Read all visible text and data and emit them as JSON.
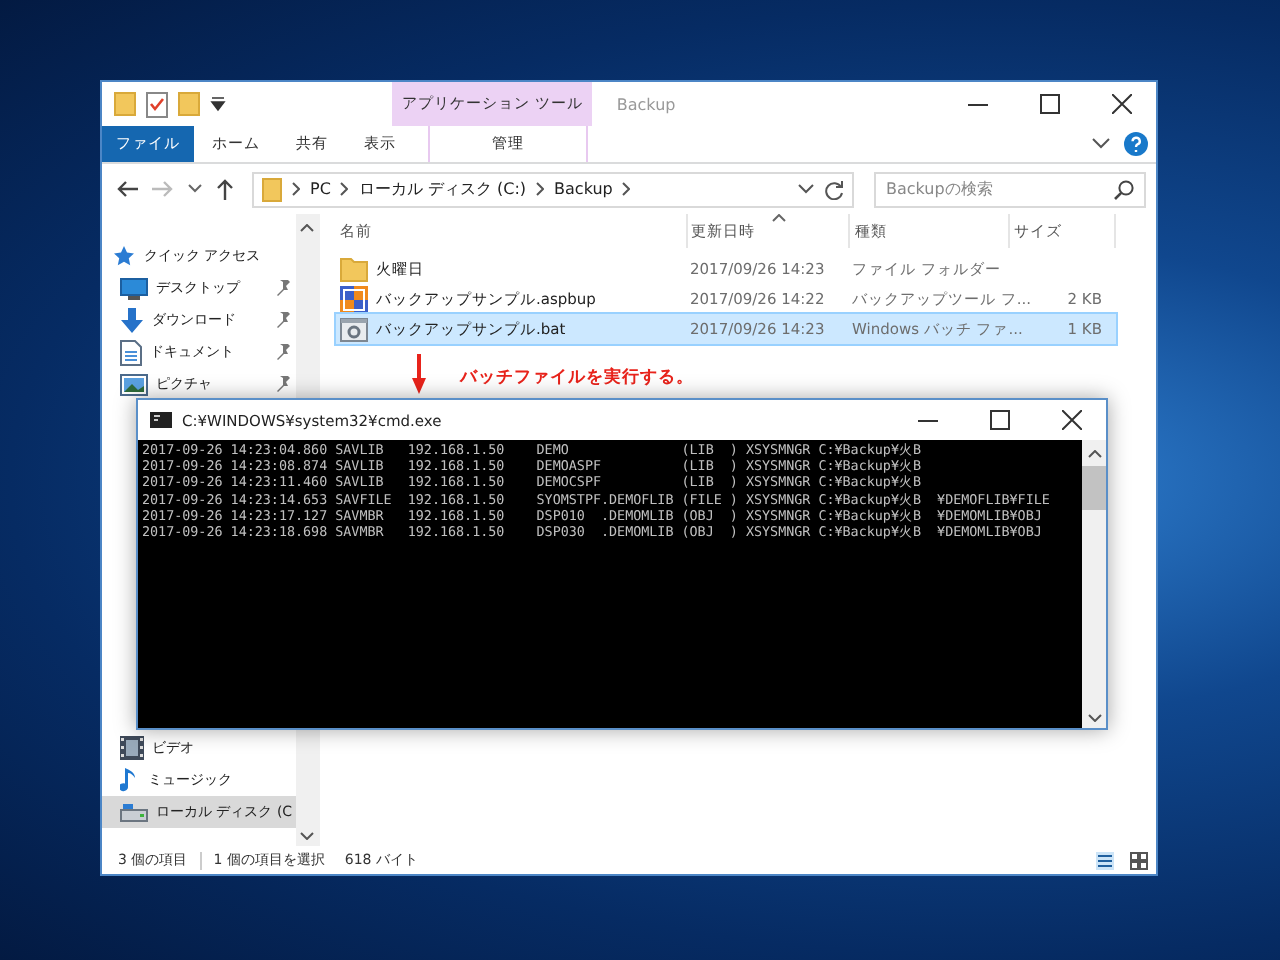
{
  "explorer": {
    "contextual_tab_group": "アプリケーション ツール",
    "title": "Backup",
    "ribbon_tabs": [
      {
        "label": "ファイル",
        "selected": true,
        "kind": "file"
      },
      {
        "label": "ホーム",
        "selected": false,
        "kind": "plain"
      },
      {
        "label": "共有",
        "selected": false,
        "kind": "plain"
      },
      {
        "label": "表示",
        "selected": false,
        "kind": "plain"
      },
      {
        "label": "管理",
        "selected": false,
        "kind": "contextual"
      }
    ],
    "address": {
      "segments": [
        "PC",
        "ローカル ディスク (C:)",
        "Backup"
      ]
    },
    "search": {
      "placeholder": "Backupの検索"
    },
    "navigation": [
      {
        "label": "クイック アクセス",
        "kind": "star",
        "pinned": false,
        "selected": false
      },
      {
        "label": "デスクトップ",
        "kind": "desktop",
        "pinned": true,
        "selected": false
      },
      {
        "label": "ダウンロード",
        "kind": "download",
        "pinned": true,
        "selected": false
      },
      {
        "label": "ドキュメント",
        "kind": "document",
        "pinned": true,
        "selected": false
      },
      {
        "label": "ピクチャ",
        "kind": "pictures",
        "pinned": true,
        "selected": false
      },
      {
        "label": "ビデオ",
        "kind": "video",
        "pinned": false,
        "selected": false
      },
      {
        "label": "ミュージック",
        "kind": "music",
        "pinned": false,
        "selected": false
      },
      {
        "label": "ローカル ディスク (C",
        "kind": "drive",
        "pinned": false,
        "selected": true
      }
    ],
    "columns": [
      {
        "label": "名前",
        "sorted": false
      },
      {
        "label": "更新日時",
        "sorted": true
      },
      {
        "label": "種類",
        "sorted": false
      },
      {
        "label": "サイズ",
        "sorted": false
      }
    ],
    "files": [
      {
        "kind": "folder",
        "name": "火曜日",
        "modified": "2017/09/26 14:23",
        "type": "ファイル フォルダー",
        "selected": false
      },
      {
        "kind": "backup",
        "name": "バックアップサンプル.aspbup",
        "modified": "2017/09/26 14:22",
        "type": "バックアップツール フ...",
        "size": "2 KB",
        "selected": false
      },
      {
        "kind": "batch",
        "name": "バックアップサンプル.bat",
        "modified": "2017/09/26 14:23",
        "type": "Windows バッチ ファ...",
        "size": "1 KB",
        "selected": true
      }
    ],
    "annotation": "バッチファイルを実行する。",
    "status_bar": {
      "item_count": "3 個の項目",
      "selection": "1 個の項目を選択",
      "selection_size": "618 バイト"
    }
  },
  "console": {
    "title": "C:¥WINDOWS¥system32¥cmd.exe",
    "lines": [
      "2017-09-26 14:23:04.860 SAVLIB   192.168.1.50    DEMO              (LIB  ) XSYSMNGR C:¥Backup¥火B",
      "2017-09-26 14:23:08.874 SAVLIB   192.168.1.50    DEMOASPF          (LIB  ) XSYSMNGR C:¥Backup¥火B",
      "2017-09-26 14:23:11.460 SAVLIB   192.168.1.50    DEMOCSPF          (LIB  ) XSYSMNGR C:¥Backup¥火B",
      "2017-09-26 14:23:14.653 SAVFILE  192.168.1.50    SYOMSTPF.DEMOFLIB (FILE ) XSYSMNGR C:¥Backup¥火B  ¥DEMOFLIB¥FILE",
      "2017-09-26 14:23:17.127 SAVMBR   192.168.1.50    DSP010  .DEMOMLIB (OBJ  ) XSYSMNGR C:¥Backup¥火B  ¥DEMOMLIB¥OBJ",
      "2017-09-26 14:23:18.698 SAVMBR   192.168.1.50    DSP030  .DEMOMLIB (OBJ  ) XSYSMNGR C:¥Backup¥火B  ¥DEMOMLIB¥OBJ"
    ]
  }
}
